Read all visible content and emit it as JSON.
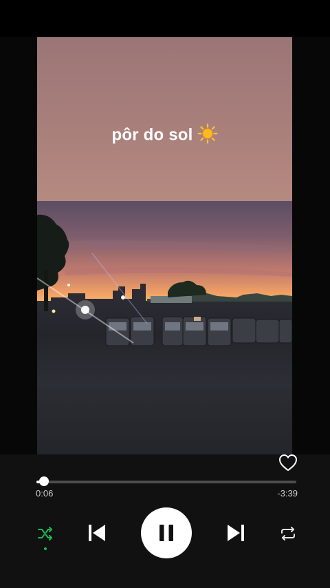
{
  "story": {
    "caption": "pôr do sol",
    "caption_emoji": "sun"
  },
  "player": {
    "elapsed": "0:06",
    "remaining": "-3:39",
    "progress_fraction": 0.03,
    "liked": false,
    "shuffle_on": true,
    "repeat_on": false,
    "state": "playing"
  },
  "colors": {
    "accent_green": "#1db954",
    "track_bg": "#4d4d4d",
    "track_fill": "#ffffff"
  },
  "icons": {
    "like": "heart-outline-icon",
    "shuffle": "shuffle-icon",
    "previous": "skip-previous-icon",
    "pause": "pause-icon",
    "next": "skip-next-icon",
    "repeat": "repeat-icon"
  }
}
